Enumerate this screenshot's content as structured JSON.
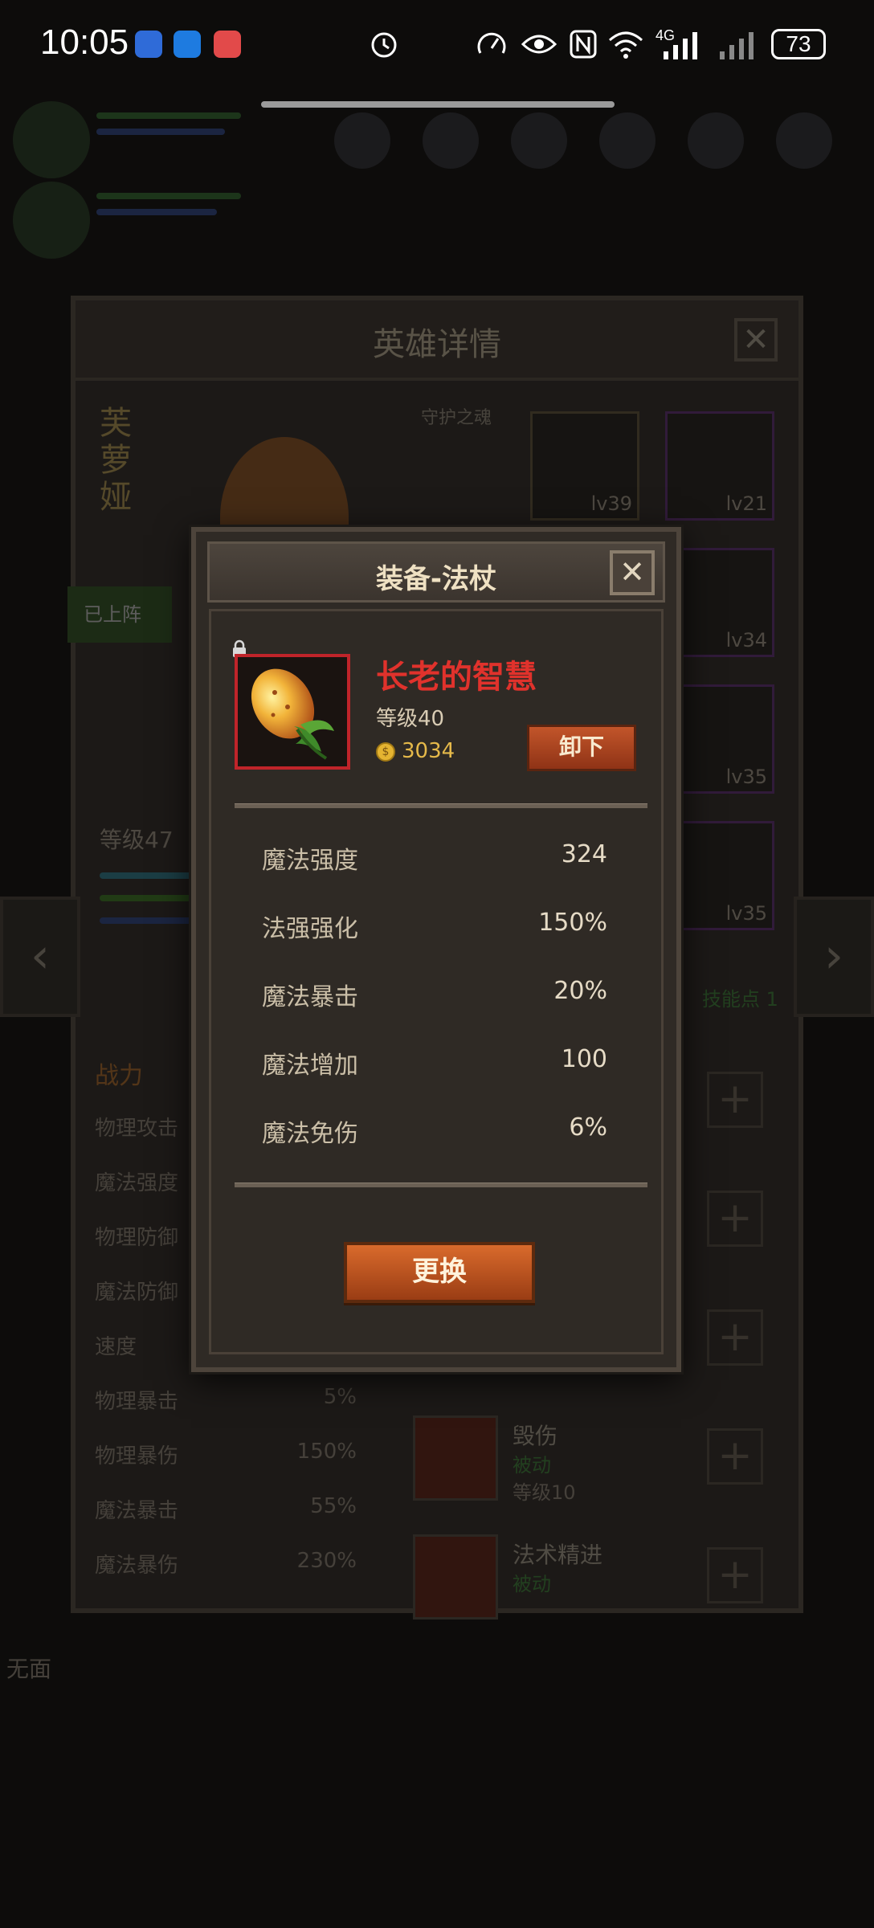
{
  "status_bar": {
    "time": "10:05",
    "network": "4G",
    "battery": "73"
  },
  "background": {
    "hero_title": "英雄详情",
    "hero_name": "芙萝娅",
    "guard_label": "守护之魂",
    "deployed_label": "已上阵",
    "level": "等级47",
    "equipment": [
      {
        "level": "lv39"
      },
      {
        "level": "lv21"
      },
      {
        "level": "lv34"
      },
      {
        "level": "lv35"
      },
      {
        "level": "lv35"
      }
    ],
    "skill_points": "技能点 1",
    "power_label": "战力",
    "stats": [
      {
        "label": "物理攻击",
        "value": ""
      },
      {
        "label": "魔法强度",
        "value": ""
      },
      {
        "label": "物理防御",
        "value": ""
      },
      {
        "label": "魔法防御",
        "value": ""
      },
      {
        "label": "速度",
        "value": ""
      },
      {
        "label": "物理暴击",
        "value": "5%"
      },
      {
        "label": "物理暴伤",
        "value": "150%"
      },
      {
        "label": "魔法暴击",
        "value": "55%"
      },
      {
        "label": "魔法暴伤",
        "value": "230%"
      }
    ],
    "skills": [
      {
        "name": "毁伤",
        "type": "被动",
        "level": "等级10"
      },
      {
        "name": "法术精进",
        "type": "被动",
        "level": ""
      }
    ],
    "none_label": "无面"
  },
  "dialog": {
    "title": "装备-法杖",
    "item_name": "长老的智慧",
    "item_level": "等级40",
    "price": "3034",
    "unequip_label": "卸下",
    "stats": [
      {
        "label": "魔法强度",
        "value": "324"
      },
      {
        "label": "法强强化",
        "value": "150%"
      },
      {
        "label": "魔法暴击",
        "value": "20%"
      },
      {
        "label": "魔法增加",
        "value": "100"
      },
      {
        "label": "魔法免伤",
        "value": "6%"
      }
    ],
    "replace_label": "更换",
    "colors": {
      "item_name": "#e0322c",
      "rarity_border": "#c0242a",
      "button": "#c2552a"
    }
  }
}
